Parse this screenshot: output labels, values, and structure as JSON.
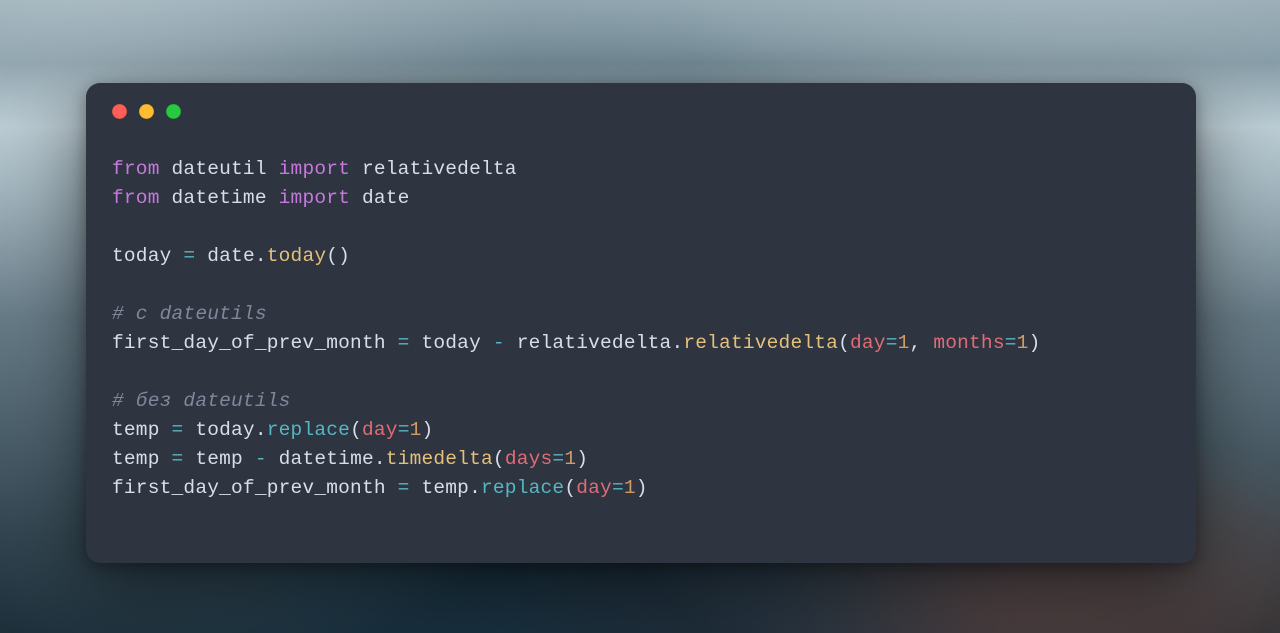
{
  "window": {
    "traffic_lights": [
      "red",
      "yellow",
      "green"
    ]
  },
  "colors": {
    "window_bg": "#2e3440",
    "keyword": "#c678dd",
    "function_call": "#e5c07b",
    "method": "#56b6c2",
    "param_name": "#e06c75",
    "number": "#d19a66",
    "comment": "#7f879a",
    "default_text": "#d8dee9"
  },
  "code": {
    "line1": {
      "kw1": "from",
      "mod1": "dateutil",
      "kw2": "import",
      "mod2": "relativedelta"
    },
    "line2": {
      "kw1": "from",
      "mod1": "datetime",
      "kw2": "import",
      "mod2": "date"
    },
    "line3": {},
    "line4": {
      "var": "today",
      "eq": "=",
      "obj": "date",
      "dot": ".",
      "fn": "today",
      "paren": "()"
    },
    "line5": {},
    "line6": {
      "comment": "# c dateutils"
    },
    "line7": {
      "var": "first_day_of_prev_month",
      "eq": "=",
      "lhs": "today",
      "minus": "-",
      "mod": "relativedelta",
      "dot": ".",
      "fn": "relativedelta",
      "open": "(",
      "p1": "day",
      "eq1": "=",
      "n1": "1",
      "comma": ",",
      "p2": "months",
      "eq2": "=",
      "n2": "1",
      "close": ")"
    },
    "line8": {},
    "line9": {
      "comment": "# без dateutils"
    },
    "line10": {
      "var": "temp",
      "eq": "=",
      "obj": "today",
      "dot": ".",
      "fn": "replace",
      "open": "(",
      "p1": "day",
      "eq1": "=",
      "n1": "1",
      "close": ")"
    },
    "line11": {
      "var": "temp",
      "eq": "=",
      "lhs": "temp",
      "minus": "-",
      "mod": "datetime",
      "dot": ".",
      "fn": "timedelta",
      "open": "(",
      "p1": "days",
      "eq1": "=",
      "n1": "1",
      "close": ")"
    },
    "line12": {
      "var": "first_day_of_prev_month",
      "eq": "=",
      "obj": "temp",
      "dot": ".",
      "fn": "replace",
      "open": "(",
      "p1": "day",
      "eq1": "=",
      "n1": "1",
      "close": ")"
    }
  }
}
